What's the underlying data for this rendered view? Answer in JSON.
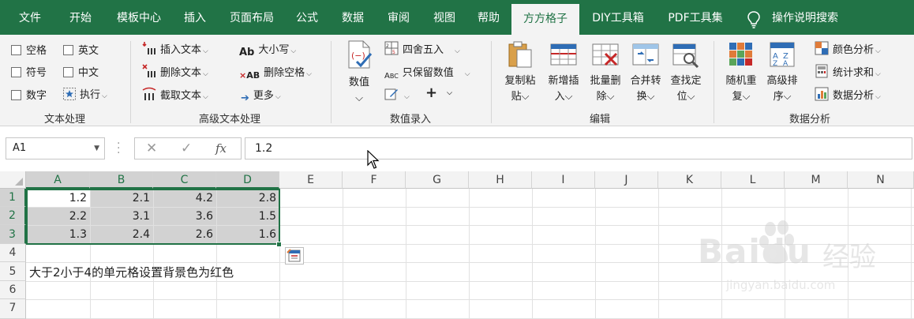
{
  "tabs": [
    "文件",
    "开始",
    "模板中心",
    "插入",
    "页面布局",
    "公式",
    "数据",
    "审阅",
    "视图",
    "帮助",
    "方方格子",
    "DIY工具箱",
    "PDF工具集"
  ],
  "active_tab": "方方格子",
  "tell_me": "操作说明搜索",
  "ribbon": {
    "text_group": {
      "label": "文本处理",
      "checks": [
        "空格",
        "英文",
        "符号",
        "中文",
        "数字"
      ],
      "exec": "执行"
    },
    "adv_text_group": {
      "label": "高级文本处理",
      "insert_text": "插入文本",
      "delete_text": "删除文本",
      "extract_text": "截取文本",
      "case": "大小写",
      "delete_space": "删除空格",
      "more": "更多"
    },
    "value_group": {
      "label": "数值录入",
      "value": "数值",
      "round": "四舍五入",
      "keep_value": "只保留数值",
      "plus": "+"
    },
    "edit_group": {
      "label": "编辑",
      "copy_paste": [
        "复制粘",
        "贴"
      ],
      "add_insert": [
        "新增插",
        "入"
      ],
      "batch_delete": [
        "批量删",
        "除"
      ],
      "merge_convert": [
        "合并转",
        "换"
      ],
      "find_locate": [
        "查找定",
        "位"
      ]
    },
    "analysis_group": {
      "label": "数据分析",
      "random_repeat": [
        "随机重",
        "复"
      ],
      "advanced_sort": [
        "高级排",
        "序"
      ],
      "color_analysis": "颜色分析",
      "stat_sum": "统计求和",
      "data_analysis": "数据分析"
    }
  },
  "formula_bar": {
    "name_box": "A1",
    "fx": "fx",
    "value": "1.2"
  },
  "sheet": {
    "columns": [
      "A",
      "B",
      "C",
      "D",
      "E",
      "F",
      "G",
      "H",
      "I",
      "J",
      "K",
      "L",
      "M",
      "N"
    ],
    "rows": [
      "1",
      "2",
      "3",
      "4",
      "5",
      "6",
      "7"
    ],
    "data": [
      [
        "1.2",
        "2.1",
        "4.2",
        "2.8"
      ],
      [
        "2.2",
        "3.1",
        "3.6",
        "1.5"
      ],
      [
        "1.3",
        "2.4",
        "2.6",
        "1.6"
      ]
    ],
    "note": "大于2小于4的单元格设置背景色为红色"
  },
  "watermark": {
    "brand": "Baidu",
    "cn": "经验",
    "url": "jingyan.baidu.com"
  },
  "colors": {
    "accent": "#217346",
    "ribbon_bg": "#f3f3f3",
    "selection": "#d2d2d2"
  }
}
